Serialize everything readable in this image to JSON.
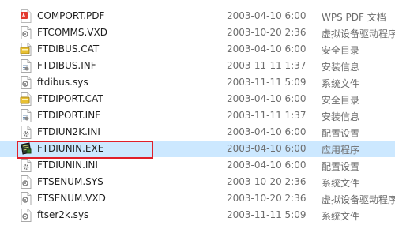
{
  "files": [
    {
      "name": "COMPORT.PDF",
      "date": "2003-04-10 6:00",
      "type": "WPS PDF 文档",
      "icon": "pdf-file-icon",
      "selected": false
    },
    {
      "name": "FTCOMMS.VXD",
      "date": "2003-10-20 2:36",
      "type": "虚拟设备驱动程序",
      "icon": "system-file-icon",
      "selected": false
    },
    {
      "name": "FTDIBUS.CAT",
      "date": "2003-04-10 6:00",
      "type": "安全目录",
      "icon": "security-catalog-icon",
      "selected": false
    },
    {
      "name": "FTDIBUS.INF",
      "date": "2003-11-11 1:37",
      "type": "安装信息",
      "icon": "setup-info-icon",
      "selected": false
    },
    {
      "name": "ftdibus.sys",
      "date": "2003-11-11 5:09",
      "type": "系统文件",
      "icon": "system-file-icon",
      "selected": false
    },
    {
      "name": "FTDIPORT.CAT",
      "date": "2003-04-10 6:00",
      "type": "安全目录",
      "icon": "security-catalog-icon",
      "selected": false
    },
    {
      "name": "FTDIPORT.INF",
      "date": "2003-11-11 1:37",
      "type": "安装信息",
      "icon": "setup-info-icon",
      "selected": false
    },
    {
      "name": "FTDIUN2K.INI",
      "date": "2003-04-10 6:00",
      "type": "配置设置",
      "icon": "config-file-icon",
      "selected": false
    },
    {
      "name": "FTDIUNIN.EXE",
      "date": "2003-04-10 6:00",
      "type": "应用程序",
      "icon": "application-icon",
      "selected": true
    },
    {
      "name": "FTDIUNIN.INI",
      "date": "2003-04-10 6:00",
      "type": "配置设置",
      "icon": "config-file-icon",
      "selected": false
    },
    {
      "name": "FTSENUM.SYS",
      "date": "2003-10-20 2:36",
      "type": "系统文件",
      "icon": "system-file-icon",
      "selected": false
    },
    {
      "name": "FTSENUM.VXD",
      "date": "2003-10-20 2:36",
      "type": "虚拟设备驱动程序",
      "icon": "system-file-icon",
      "selected": false
    },
    {
      "name": "ftser2k.sys",
      "date": "2003-11-11 5:09",
      "type": "系统文件",
      "icon": "system-file-icon",
      "selected": false
    }
  ],
  "colors": {
    "selection_bg": "#cce8ff",
    "highlight_border": "#e0202a",
    "text": "#1e1e1e",
    "secondary_text": "#6d6d6d"
  }
}
